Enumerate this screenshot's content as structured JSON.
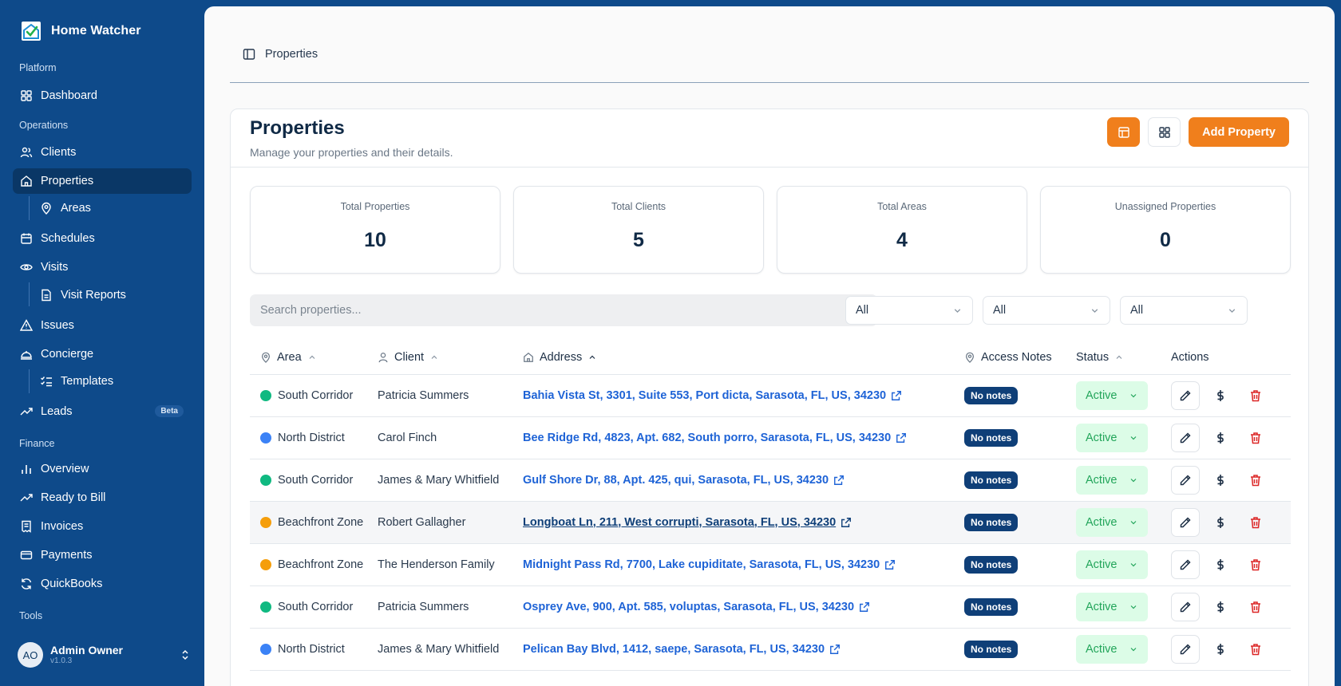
{
  "app": {
    "name": "Home Watcher"
  },
  "sidebar": {
    "sections": {
      "platform": "Platform",
      "operations": "Operations",
      "finance": "Finance",
      "tools": "Tools"
    },
    "items": {
      "dashboard": "Dashboard",
      "clients": "Clients",
      "properties": "Properties",
      "areas": "Areas",
      "schedules": "Schedules",
      "visits": "Visits",
      "visit_reports": "Visit Reports",
      "issues": "Issues",
      "concierge": "Concierge",
      "templates": "Templates",
      "leads": "Leads",
      "leads_badge": "Beta",
      "overview": "Overview",
      "ready_to_bill": "Ready to Bill",
      "invoices": "Invoices",
      "payments": "Payments",
      "quickbooks": "QuickBooks"
    },
    "user": {
      "initials": "AO",
      "name": "Admin Owner",
      "version": "v1.0.3"
    }
  },
  "topbar": {
    "breadcrumb": "Properties"
  },
  "page": {
    "title": "Properties",
    "subtitle": "Manage your properties and their details.",
    "add_button": "Add Property"
  },
  "stats": [
    {
      "label": "Total Properties",
      "value": "10"
    },
    {
      "label": "Total Clients",
      "value": "5"
    },
    {
      "label": "Total Areas",
      "value": "4"
    },
    {
      "label": "Unassigned Properties",
      "value": "0"
    }
  ],
  "filters": {
    "search_placeholder": "Search properties...",
    "selects": [
      "All",
      "All",
      "All"
    ]
  },
  "table": {
    "headers": {
      "area": "Area",
      "client": "Client",
      "address": "Address",
      "access_notes": "Access Notes",
      "status": "Status",
      "actions": "Actions"
    },
    "rows": [
      {
        "area": "South Corridor",
        "area_color": "#10b981",
        "client": "Patricia Summers",
        "address": "Bahia Vista St, 3301, Suite 553, Port dicta, Sarasota, FL, US, 34230",
        "notes": "No notes",
        "status": "Active"
      },
      {
        "area": "North District",
        "area_color": "#3b82f6",
        "client": "Carol Finch",
        "address": "Bee Ridge Rd, 4823, Apt. 682, South porro, Sarasota, FL, US, 34230",
        "notes": "No notes",
        "status": "Active"
      },
      {
        "area": "South Corridor",
        "area_color": "#10b981",
        "client": "James & Mary Whitfield",
        "address": "Gulf Shore Dr, 88, Apt. 425, qui, Sarasota, FL, US, 34230",
        "notes": "No notes",
        "status": "Active"
      },
      {
        "area": "Beachfront Zone",
        "area_color": "#f59e0b",
        "client": "Robert Gallagher",
        "address": "Longboat Ln, 211, West corrupti, Sarasota, FL, US, 34230",
        "notes": "No notes",
        "status": "Active"
      },
      {
        "area": "Beachfront Zone",
        "area_color": "#f59e0b",
        "client": "The Henderson Family",
        "address": "Midnight Pass Rd, 7700, Lake cupiditate, Sarasota, FL, US, 34230",
        "notes": "No notes",
        "status": "Active"
      },
      {
        "area": "South Corridor",
        "area_color": "#10b981",
        "client": "Patricia Summers",
        "address": "Osprey Ave, 900, Apt. 585, voluptas, Sarasota, FL, US, 34230",
        "notes": "No notes",
        "status": "Active"
      },
      {
        "area": "North District",
        "area_color": "#3b82f6",
        "client": "James & Mary Whitfield",
        "address": "Pelican Bay Blvd, 1412, saepe, Sarasota, FL, US, 34230",
        "notes": "No notes",
        "status": "Active"
      }
    ]
  },
  "colors": {
    "sidebar": "#0e4a8a",
    "accent": "#f07f1c",
    "link": "#1e63d6",
    "badge": "#0f3f78",
    "status_bg": "#dcfce7",
    "status_text": "#22a55a",
    "danger": "#dc2626"
  }
}
